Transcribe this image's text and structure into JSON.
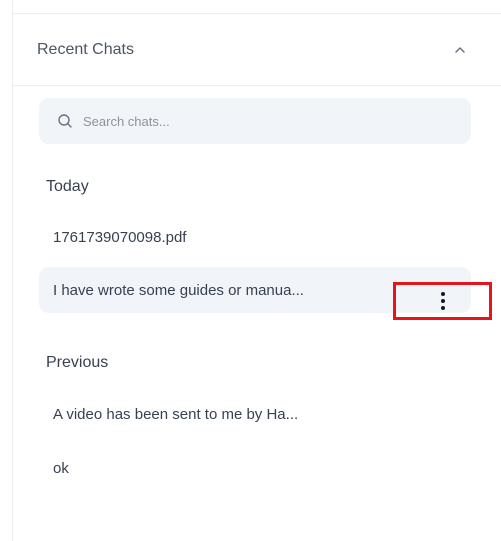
{
  "recent_chats": {
    "title": "Recent Chats",
    "collapse_icon": "chevron-up-icon"
  },
  "search": {
    "placeholder": "Search chats...",
    "icon": "search-icon",
    "value": ""
  },
  "sections": {
    "today": {
      "label": "Today",
      "items": [
        {
          "title": "1761739070098.pdf"
        },
        {
          "title": "I have wrote some guides or manua..."
        }
      ]
    },
    "previous": {
      "label": "Previous",
      "items": [
        {
          "title": "A video has been sent to me by Ha..."
        },
        {
          "title": "ok"
        }
      ]
    }
  },
  "more_options_icon": "more-vertical-icon",
  "colors": {
    "highlight": "#e8141b",
    "active_bg": "#f1f4f8"
  }
}
